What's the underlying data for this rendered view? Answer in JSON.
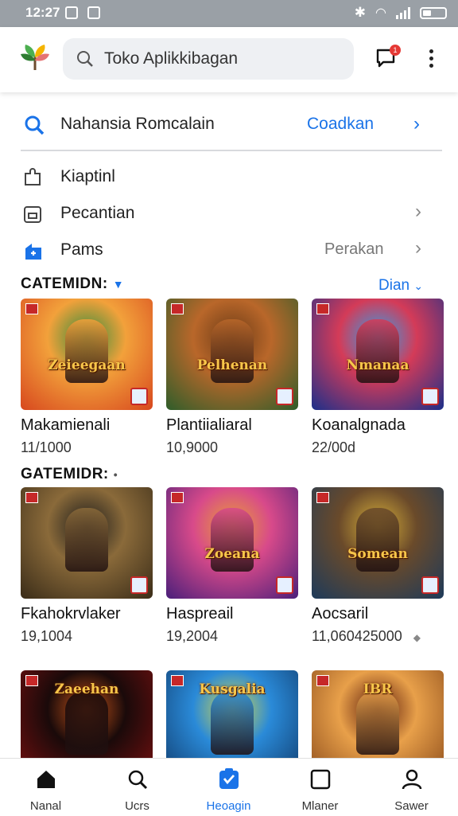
{
  "status_bar": {
    "time": "12:27"
  },
  "header": {
    "search_value": "Toko Aplikkibagan",
    "notification_count": "1"
  },
  "promo": {
    "text": "Nahansia Romcalain",
    "link": "Coadkan"
  },
  "menu": [
    {
      "label": "Kiaptinl",
      "value": "",
      "icon": "puzzle-icon"
    },
    {
      "label": "Pecantian",
      "value": "",
      "icon": "store-icon"
    },
    {
      "label": "Pams",
      "value": "Perakan",
      "icon": "game-controller-icon"
    }
  ],
  "sections": [
    {
      "title": "CATEMIDN:",
      "see_all": "Dian"
    },
    {
      "title": "GATEMIDR:"
    }
  ],
  "apps_row1": [
    {
      "name": "Makamienali",
      "count": "11/1000",
      "art": "Zeieegaan",
      "colors": [
        "#d7471e",
        "#f2a13b",
        "#2f8b3c"
      ]
    },
    {
      "name": "Plantiialiaral",
      "count": "10,9000",
      "art": "Pelhenan",
      "colors": [
        "#2e5d2a",
        "#b9672a",
        "#6b3b16"
      ]
    },
    {
      "name": "Koanalgnada",
      "count": "22/00d",
      "art": "Nmanaa",
      "colors": [
        "#1b2f8a",
        "#d43b58",
        "#2fa0e8"
      ]
    }
  ],
  "apps_row2": [
    {
      "name": "Fkahokrvlaker",
      "count": "19,1004",
      "art": "",
      "colors": [
        "#3a2c18",
        "#8a6a3a",
        "#1b1b1b"
      ]
    },
    {
      "name": "Haspreail",
      "count": "19,2004",
      "art": "Zoeana",
      "colors": [
        "#4a1f7a",
        "#d84a8a",
        "#e8a034"
      ]
    },
    {
      "name": "Aocsaril",
      "count": "11,060425000",
      "art": "Somean",
      "colors": [
        "#1d3a5a",
        "#6a4a2a",
        "#d8b03a"
      ]
    }
  ],
  "apps_row3": [
    {
      "art": "Zaeehan",
      "colors": [
        "#7a1010",
        "#1a0a0a",
        "#c8551a"
      ]
    },
    {
      "art": "Kusgalia",
      "colors": [
        "#103a6a",
        "#2a8ad8",
        "#d8d84a"
      ]
    },
    {
      "art": "IBR",
      "colors": [
        "#8a4a1a",
        "#e8a04a",
        "#5a1a0a"
      ]
    }
  ],
  "bottom_nav": [
    {
      "label": "Nanal",
      "icon": "home-icon",
      "active": false
    },
    {
      "label": "Ucrs",
      "icon": "search-icon",
      "active": false
    },
    {
      "label": "Heoagin",
      "icon": "heart-box-icon",
      "active": true
    },
    {
      "label": "Mlaner",
      "icon": "square-icon",
      "active": false
    },
    {
      "label": "Sawer",
      "icon": "person-icon",
      "active": false
    }
  ]
}
